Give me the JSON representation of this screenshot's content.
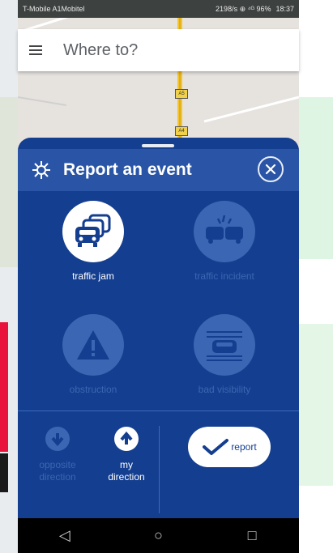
{
  "status_bar": {
    "carrier": "T-Mobile A1Mobitel",
    "indicators": "2198/s ⊕ ⁴ᴳ 96%",
    "time": "18:37"
  },
  "search": {
    "menu_icon": "menu-icon",
    "placeholder": "Where to?"
  },
  "map": {
    "road_signs": [
      "A5",
      "A4"
    ]
  },
  "sheet": {
    "title": "Report an event",
    "title_icon": "traffic-category-icon",
    "close_icon": "close-icon",
    "events": [
      {
        "label": "traffic jam",
        "icon": "traffic-jam-icon",
        "active": true
      },
      {
        "label": "traffic incident",
        "icon": "traffic-incident-icon",
        "active": false
      },
      {
        "label": "obstruction",
        "icon": "obstruction-icon",
        "active": false
      },
      {
        "label": "bad visibility",
        "icon": "bad-visibility-icon",
        "active": false
      }
    ],
    "directions": [
      {
        "label_line1": "opposite",
        "label_line2": "direction",
        "icon": "arrow-down-icon",
        "active": false
      },
      {
        "label_line1": "my",
        "label_line2": "direction",
        "icon": "arrow-up-icon",
        "active": true
      }
    ],
    "report_button": {
      "label": "report",
      "icon": "checkmark-icon"
    }
  },
  "nav_bar": {
    "back": "◁",
    "home": "○",
    "recents": "□"
  },
  "colors": {
    "sheet_bg": "#143e8f",
    "header_bg": "#2a55a6",
    "inactive": "#3b66b3",
    "active": "#ffffff"
  }
}
